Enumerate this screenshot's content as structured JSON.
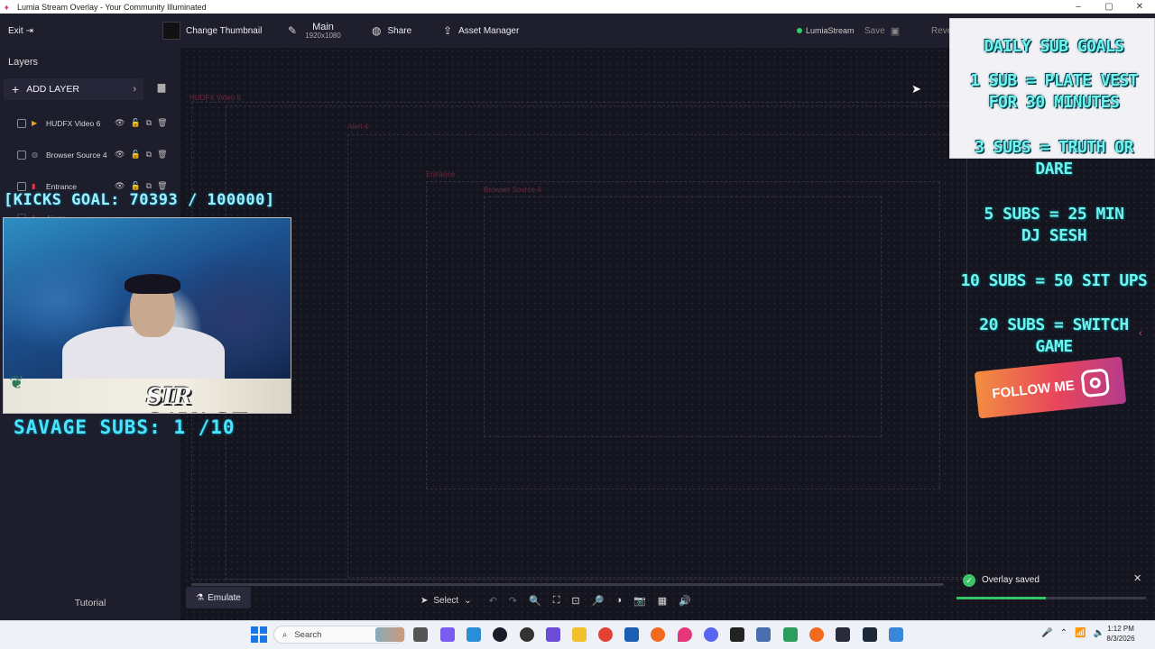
{
  "window": {
    "title": "Lumia Stream Overlay - Your Community Illuminated"
  },
  "toolbar": {
    "exit_label": "Exit",
    "change_thumbnail_label": "Change Thumbnail",
    "main_label": "Main",
    "main_resolution": "1920x1080",
    "share_label": "Share",
    "asset_manager_label": "Asset Manager",
    "lumia_status_label": "LumiaStream",
    "save_label": "Save",
    "revert_label": "Reve"
  },
  "sidebar": {
    "layers_title": "Layers",
    "add_layer_label": "ADD LAYER",
    "layers": [
      {
        "name": "HUDFX Video 6",
        "icon": "video-icon",
        "color": "#e8a020"
      },
      {
        "name": "Browser Source 4",
        "icon": "globe-icon",
        "color": "#8a8a9a"
      },
      {
        "name": "Entrance",
        "icon": "entrance-icon",
        "color": "#e53750"
      },
      {
        "name": "Alerts",
        "icon": "alert-icon",
        "color": "#e53750"
      }
    ],
    "tutorial_label": "Tutorial"
  },
  "canvas": {
    "ghost_labels": [
      "HUDFX Video 6",
      "Alert 4",
      "Entrance",
      "Browser Source 4"
    ]
  },
  "bottom_bar": {
    "emulate_label": "Emulate",
    "select_label": "Select"
  },
  "overlay": {
    "kicks_goal": "[KICKS GOAL: 70393 / 100000]",
    "cam_name": "SIR SAVAGE",
    "savage_subs": "SAVAGE SUBS: 1  /10",
    "goals": [
      "DAILY SUB GOALS",
      "1 SUB = PLATE VEST FOR 30 MINUTES",
      "3 SUBS = TRUTH OR DARE",
      "5 SUBS = 25 MIN DJ SESH",
      "10 SUBS = 50 SIT UPS",
      "20 SUBS = SWITCH GAME"
    ],
    "follow_me_label": "FOLLOW ME"
  },
  "toast": {
    "message": "Overlay saved",
    "progress": 0.47
  },
  "taskbar": {
    "search_placeholder": "Search",
    "time": "1:12 PM",
    "date": "8/3/2026"
  },
  "colors": {
    "accent": "#e53777",
    "goal_text": "#6ef6ee",
    "kicks_text": "#9ff0ff",
    "success": "#3cc46a"
  }
}
